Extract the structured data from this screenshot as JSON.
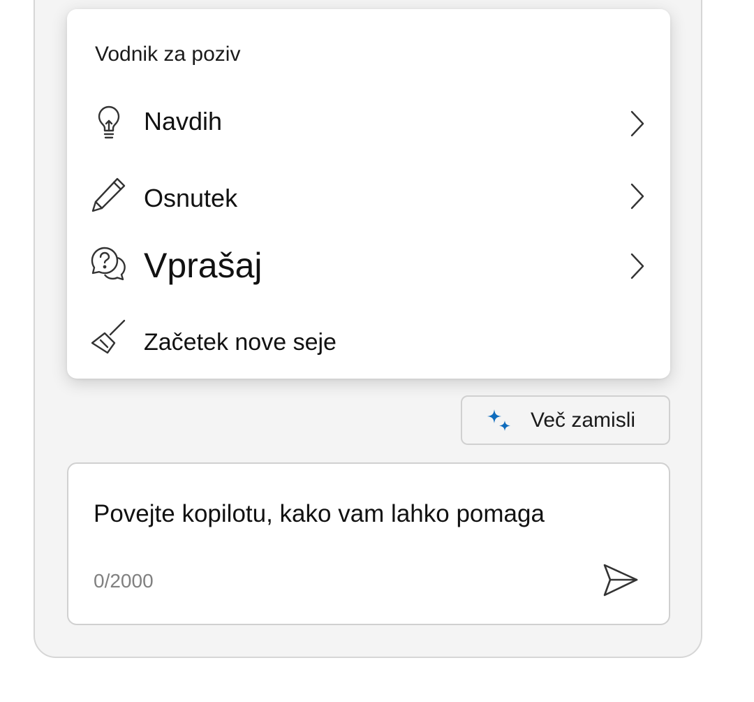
{
  "prompt_guide": {
    "title": "Vodnik za poziv",
    "items": [
      {
        "label": "Navdih",
        "icon": "lightbulb-icon",
        "has_submenu": true
      },
      {
        "label": "Osnutek",
        "icon": "pencil-icon",
        "has_submenu": true
      },
      {
        "label": "Vprašaj",
        "icon": "question-chat-icon",
        "has_submenu": true
      },
      {
        "label": "Začetek nove seje",
        "icon": "broom-icon",
        "has_submenu": false
      }
    ]
  },
  "more_ideas": {
    "label": "Več zamisli",
    "icon": "sparkle-icon",
    "icon_color": "#0f6cbd"
  },
  "composer": {
    "placeholder": "Povejte kopilotu, kako vam lahko pomaga",
    "char_count": "0/2000",
    "send_icon": "send-icon"
  }
}
